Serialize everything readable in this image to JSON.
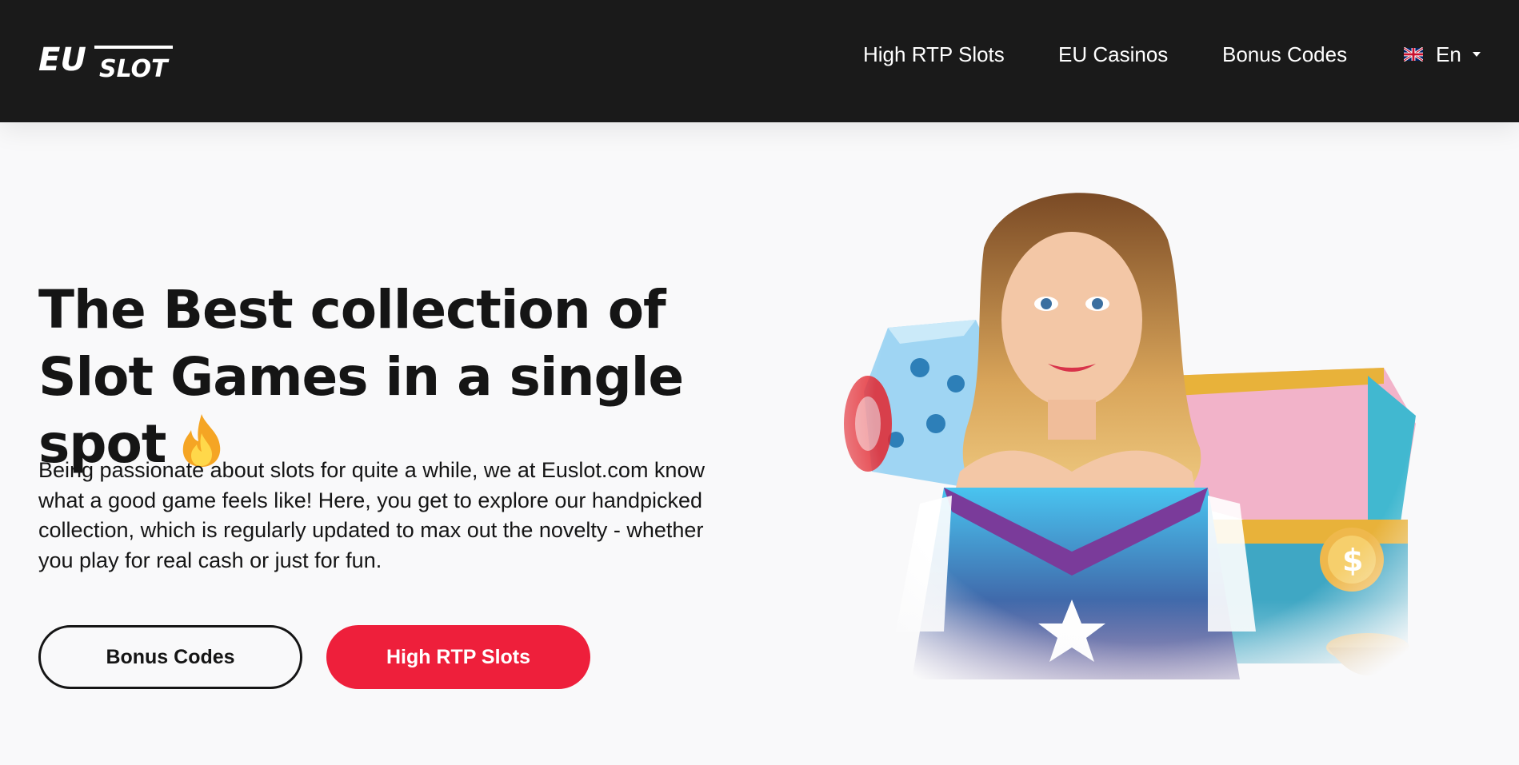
{
  "header": {
    "logo_text_top": "EU",
    "logo_text_bottom": "SLOT",
    "nav": [
      {
        "label": "High RTP Slots"
      },
      {
        "label": "EU Casinos"
      },
      {
        "label": "Bonus Codes"
      }
    ],
    "language": {
      "label": "En",
      "flag_icon": "uk-flag-icon"
    }
  },
  "hero": {
    "title": "The Best collection of Slot Games in a single spot",
    "title_icon": "fire-icon",
    "description": "Being passionate about slots for quite a while, we at Euslot.com know what a good game feels like! Here, you get to explore our handpicked collection, which is regularly updated to max out the novelty - whether you play for real cash or just for fun.",
    "buttons": {
      "secondary": "Bonus Codes",
      "primary": "High RTP Slots"
    }
  },
  "colors": {
    "header_bg": "#1a1a1a",
    "page_bg": "#f9f9fa",
    "accent": "#ee1f3b",
    "text": "#151515"
  }
}
